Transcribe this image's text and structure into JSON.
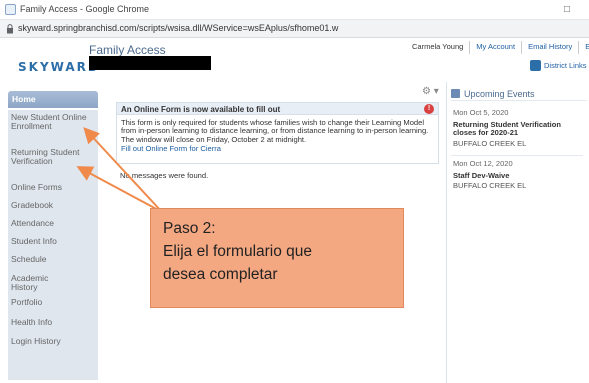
{
  "browser": {
    "title": "Family Access - Google Chrome",
    "url": "skyward.springbranchisd.com/scripts/wsisa.dll/WService=wsEAplus/sfhome01.w",
    "window_button": "□"
  },
  "header": {
    "logo": "SKYWARD",
    "app_title": "Family Access",
    "user_menu": [
      "Carmela Young",
      "My Account",
      "Email History",
      "Exit"
    ],
    "district_links": "District Links"
  },
  "nav": {
    "items": [
      "Home",
      "New Student Online Enrollment",
      "Returning Student Verification",
      "Online Forms",
      "Gradebook",
      "Attendance",
      "Student Info",
      "Schedule",
      "Academic History",
      "Portfolio",
      "Health Info",
      "Login History"
    ]
  },
  "main": {
    "gear": "⚙ ▾",
    "form_panel": {
      "title": "An Online Form is now available to fill out",
      "alert": "!",
      "body": "This form is only required for students whose families wish to change their Learning Model from in-person learning to distance learning, or from distance learning to in-person learning. The window will close on Friday, October 2 at midnight.",
      "link": "Fill out Online Form for Cierra"
    },
    "no_messages": "No messages were found."
  },
  "events": {
    "title": "Upcoming Events",
    "list": [
      {
        "date": "Mon Oct 5, 2020",
        "title": "Returning Student Verification closes for 2020-21",
        "location": "BUFFALO CREEK EL"
      },
      {
        "date": "Mon Oct 12, 2020",
        "title": "Staff Dev-Waive",
        "location": "BUFFALO CREEK EL"
      }
    ]
  },
  "annotation": {
    "line1": "Paso 2:",
    "line2": "Elija el formulario que",
    "line3": "desea completar"
  },
  "colors": {
    "accent": "#2c6ea8",
    "annotation_fill": "#f4a882",
    "arrow": "#f08a4b"
  }
}
